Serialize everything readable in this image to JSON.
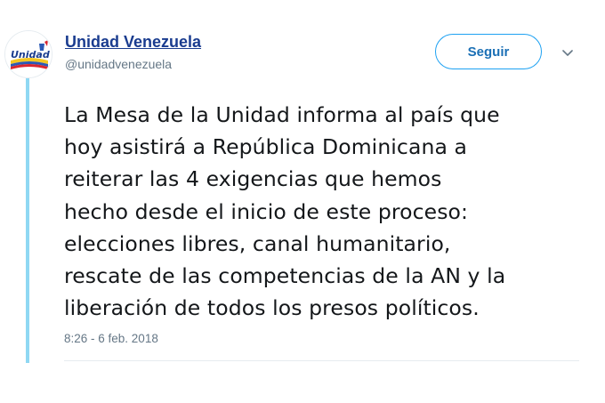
{
  "tweet": {
    "author": {
      "name": "Unidad Venezuela",
      "handle": "@unidadvenezuela",
      "avatar_logo_text": "Unidad"
    },
    "follow_button_label": "Seguir",
    "menu_icon": "chevron-down-icon",
    "text_lines": [
      "La Mesa de la Unidad informa al país que",
      "hoy asistirá a República Dominicana a",
      "reiterar las 4 exigencias que hemos",
      "hecho desde el inicio de este proceso:",
      "elecciones libres, canal humanitario,",
      "rescate de las competencias de la AN y la",
      "liberación de todos los presos políticos."
    ],
    "timestamp": "8:26 - 6 feb. 2018"
  },
  "colors": {
    "author_name": "#1a3c8f",
    "thread_line": "#8fd8f3",
    "follow_border": "#1da1f2",
    "follow_text": "#1a6fb5",
    "secondary_text": "#657786"
  }
}
